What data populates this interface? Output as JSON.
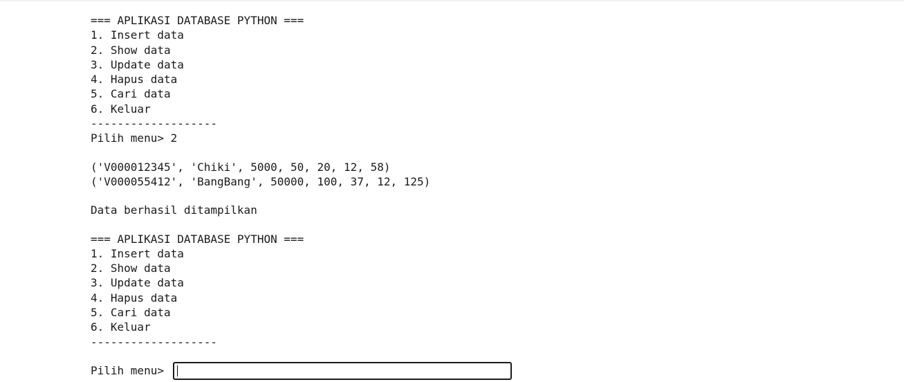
{
  "block1": {
    "title": "=== APLIKASI DATABASE PYTHON ===",
    "menu": [
      "1. Insert data",
      "2. Show data",
      "3. Update data",
      "4. Hapus data",
      "5. Cari data",
      "6. Keluar"
    ],
    "divider": "-------------------",
    "prompt": "Pilih menu> 2"
  },
  "results": [
    "('V000012345', 'Chiki', 5000, 50, 20, 12, 58)",
    "('V000055412', 'BangBang', 50000, 100, 37, 12, 125)"
  ],
  "status_message": "Data berhasil ditampilkan",
  "block2": {
    "title": "=== APLIKASI DATABASE PYTHON ===",
    "menu": [
      "1. Insert data",
      "2. Show data",
      "3. Update data",
      "4. Hapus data",
      "5. Cari data",
      "6. Keluar"
    ],
    "divider": "-------------------"
  },
  "input_prompt": {
    "label": "Pilih menu>",
    "value": ""
  }
}
